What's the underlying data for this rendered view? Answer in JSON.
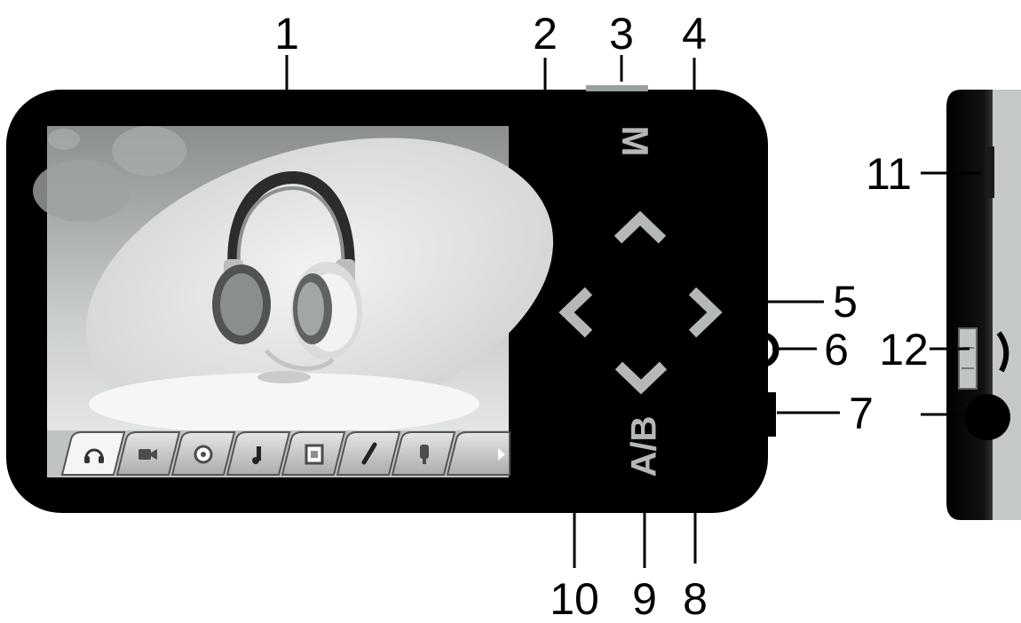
{
  "callouts": [
    {
      "id": 1,
      "label": "1"
    },
    {
      "id": 2,
      "label": "2"
    },
    {
      "id": 3,
      "label": "3"
    },
    {
      "id": 4,
      "label": "4"
    },
    {
      "id": 5,
      "label": "5"
    },
    {
      "id": 6,
      "label": "6"
    },
    {
      "id": 7,
      "label": "7"
    },
    {
      "id": 8,
      "label": "8"
    },
    {
      "id": 9,
      "label": "9"
    },
    {
      "id": 10,
      "label": "10"
    },
    {
      "id": 11,
      "label": "11"
    },
    {
      "id": 12,
      "label": "12"
    }
  ],
  "device": {
    "menu_button_label": "M",
    "ab_button_label": "A/B",
    "body_color": "#000000",
    "button_color": "#b4b8b6"
  },
  "screen": {
    "menu_icons": [
      "headphones-icon",
      "video-icon",
      "photo-icon",
      "music-icon",
      "document-icon",
      "record-icon",
      "settings-icon"
    ],
    "more_indicator": "arrow-right-icon"
  }
}
